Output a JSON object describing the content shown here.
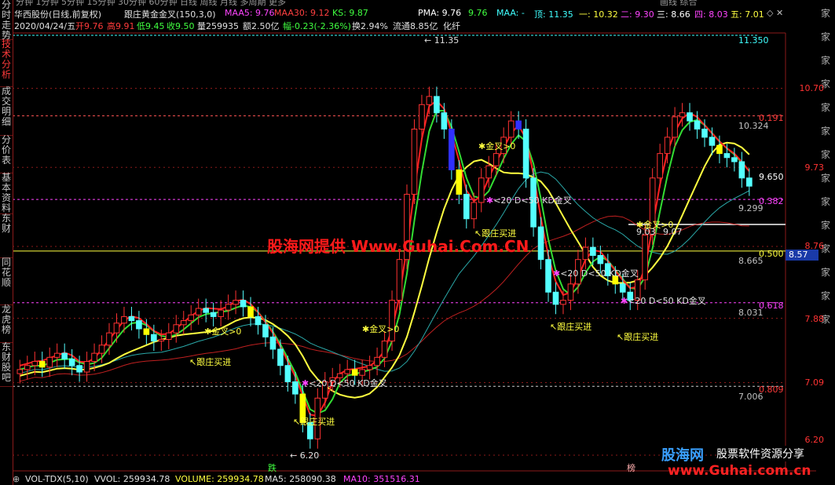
{
  "topbar": {
    "periods": "分钟 1分钟 5分钟 15分钟 30分钟 60分钟 日线 周线 月线 多周期 更多",
    "right_tabs": "画线 综合"
  },
  "title": {
    "stock": "华西股份(日线,前复权)",
    "indicator": "跟庄黄金金叉(150,3,0)",
    "maa5": "MAA5: 9.76",
    "maa30": "MAA30: 9.12",
    "ks": "KS: 9.87",
    "pma": "PMA: 9.76",
    "pma2": "9.76",
    "maa": "MAA: -",
    "ding": "顶: 11.35",
    "one": "一: 10.32",
    "two": "二: 9.30",
    "three": "三: 8.66",
    "four": "四: 8.03",
    "five": "五: 7.01",
    "icons": "◇ ✕"
  },
  "ohlc": {
    "date": "2020/04/24/五",
    "open": "开9.76",
    "high": "高9.91",
    "low": "低9.45",
    "close": "收9.50",
    "vol": "量259935",
    "amount": "额2.50亿",
    "change": "幅-0.23(-2.36%)",
    "turnover": "换2.94%",
    "float": "流通8.85亿",
    "industry": "化纤"
  },
  "left_tabs": [
    {
      "label": "分时走势",
      "active": false
    },
    {
      "label": "技术分析",
      "active": true
    },
    {
      "label": "成交明细",
      "active": false
    },
    {
      "label": "分价表",
      "active": false
    },
    {
      "label": "基本资料",
      "active": false
    },
    {
      "label": "东财",
      "active": false
    },
    {
      "label": "同花顺",
      "active": false
    },
    {
      "label": "龙虎榜",
      "active": false
    },
    {
      "label": "东财股吧",
      "active": false
    }
  ],
  "right_chars": "家家家家家家家家家家家家家家",
  "axis": {
    "prices": [
      "10.70",
      "9.73",
      "8.76",
      "7.88",
      "7.09",
      "6.20"
    ],
    "fib_labels": [
      "0.191",
      "0.382",
      "0.500",
      "0.618",
      "0.809"
    ],
    "fib_values": [
      "10.324",
      "9.299",
      "8.665",
      "8.031",
      "7.006"
    ],
    "top_label": "11.350",
    "current_price": "8.57"
  },
  "chart_data": {
    "type": "candlestick",
    "title": "跟庄黄金金叉(150,3,0)",
    "high": 11.35,
    "low": 6.2,
    "last_close": 9.5,
    "annotations": [
      "11.35",
      "6.20",
      "9.03",
      "9.07",
      "9.650"
    ],
    "signals": [
      {
        "label": "金叉>0"
      },
      {
        "label": "金叉>0"
      },
      {
        "label": "金叉>0"
      },
      {
        "label": "金叉>0"
      },
      {
        "label": "<20 D<50 KD金叉"
      },
      {
        "label": "<20 D<50 KD金叉"
      },
      {
        "label": "<20 D<50 KD金叉"
      },
      {
        "label": "<20 D<50 KD金叉"
      },
      {
        "label": "跟庄买进"
      },
      {
        "label": "跟庄买进"
      },
      {
        "label": "跟庄买进"
      },
      {
        "label": "跟庄买进"
      },
      {
        "label": "跟庄买进"
      }
    ],
    "bottom_markers": [
      "跌",
      "榜"
    ]
  },
  "watermark": "股海网提供 Www.Guhai.Com.CN",
  "logo": {
    "line1": "股海网",
    "line2": "股票软件资源分享",
    "url": "www.Guhai.com.cn"
  },
  "volume": {
    "name": "VOL-TDX(5,10)",
    "vvol": "VVOL: 259934.78",
    "volume": "VOLUME: 259934.78",
    "ma5": "MA5: 258090.38",
    "ma10": "MA10: 351516.31"
  },
  "colors": {
    "up": "#ff3232",
    "down": "#54ffff",
    "bull": "#ffff00",
    "bear": "#3030ff",
    "grid": "#8b1a1a"
  }
}
